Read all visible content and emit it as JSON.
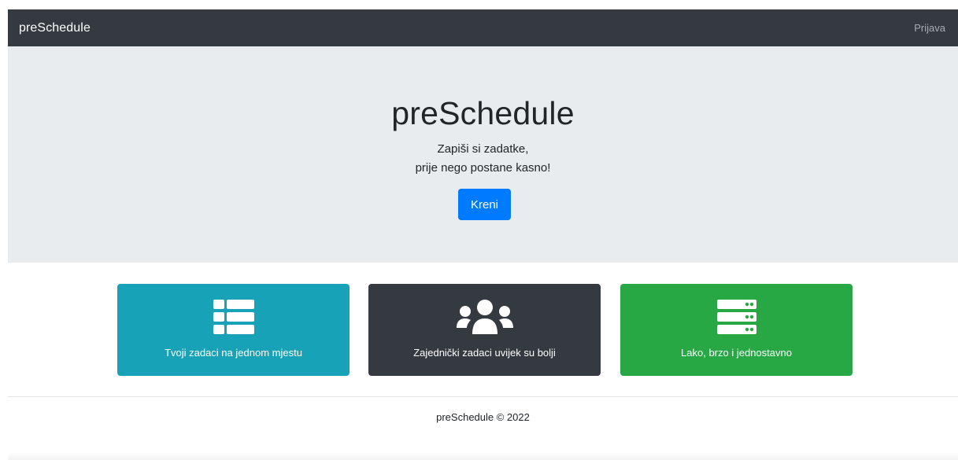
{
  "navbar": {
    "brand": "preSchedule",
    "login_link": "Prijava"
  },
  "hero": {
    "title": "preSchedule",
    "line1": "Zapiši si zadatke,",
    "line2": "prije nego postane kasno!",
    "cta_label": "Kreni",
    "cta_color": "#007bff"
  },
  "features": [
    {
      "icon": "th-list-icon",
      "label": "Tvoji zadaci na jednom mjestu",
      "color": "#17a2b8"
    },
    {
      "icon": "users-icon",
      "label": "Zajednički zadaci uvijek su bolji",
      "color": "#343a40"
    },
    {
      "icon": "server-icon",
      "label": "Lako, brzo i jednostavno",
      "color": "#28a745"
    }
  ],
  "footer": {
    "text": "preSchedule © 2022"
  }
}
